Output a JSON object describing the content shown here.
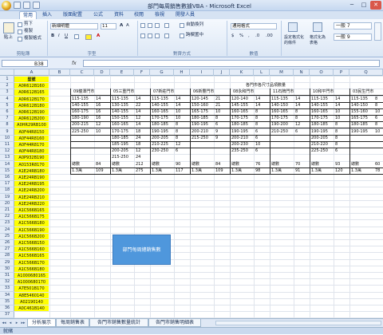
{
  "window": {
    "title": "部門每周銷售數據VBA - Microsoft Excel",
    "minimize": "─",
    "maximize": "□",
    "close": "✕"
  },
  "ribbon": {
    "tabs": [
      "常用",
      "插入",
      "版面配置",
      "公式",
      "資料",
      "校閱",
      "檢視",
      "開發人員"
    ],
    "paste": "貼上",
    "cut": "剪下",
    "copy": "複製",
    "format_painter": "複製格式",
    "font_name": "新細明體",
    "font_size": "11",
    "wrap_text": "自動換列",
    "merge_center": "跨欄置中",
    "number_format": "通用格式",
    "conditional_format": "設定格式化\n的條件",
    "format_as_table": "格式化為\n表格",
    "style_1": "一般 7",
    "style_2": "一般 9",
    "groups": [
      "剪貼簿",
      "字型",
      "對齊方式",
      "數值"
    ]
  },
  "formula_bar": {
    "name_box": "B38",
    "fx": "fx",
    "value": ""
  },
  "columns": [
    "A",
    "B",
    "C",
    "D",
    "E",
    "F",
    "G",
    "H",
    "I",
    "J",
    "K",
    "L",
    "M",
    "N",
    "O",
    "P",
    "Q"
  ],
  "rows": [
    "1",
    "2",
    "3",
    "4",
    "5",
    "6",
    "7",
    "8",
    "9",
    "10",
    "11",
    "12",
    "13",
    "14",
    "15",
    "16",
    "17",
    "18",
    "19",
    "20",
    "21",
    "22",
    "23",
    "24",
    "25",
    "26",
    "27",
    "28",
    "29",
    "30",
    "31",
    "32",
    "33",
    "34",
    "35",
    "36",
    "37"
  ],
  "col_a": [
    "型號",
    "A0R612B160",
    "A0R612B165",
    "A0R612B170",
    "A0R612B180",
    "A0R612B190",
    "A0R612B200",
    "A0HR29RB100",
    "A0F44R8150",
    "A0F44R8160",
    "A0F44R8170",
    "A0F44R8180",
    "A0P932B190",
    "A0153R8170",
    "A1E24RB180",
    "A1E24RB190",
    "A1E24RB195",
    "A1E24RB200",
    "A1E24RB210",
    "A1E24RB220",
    "A1C566B165",
    "A1C566B175",
    "A1C566B180",
    "A1C566B190",
    "A1C566B200",
    "A1C566B150",
    "A1C566B160",
    "A1C566B165",
    "A1C566B170",
    "A1C566B180",
    "A1000680165",
    "A1000680170",
    "A7E501B170",
    "A8E5460140",
    "A02190140",
    "A0C461B140"
  ],
  "table": {
    "title": "各門市各尺寸品項數量",
    "stores": [
      {
        "name": "09龍潭門市",
        "rows": [
          [
            "115-135",
            "14"
          ],
          [
            "140-155",
            "16"
          ],
          [
            "160-175",
            "16"
          ],
          [
            "180-190",
            "16"
          ],
          [
            "200-215",
            "12"
          ],
          [
            "225-250",
            "10"
          ]
        ],
        "sales_label": "總數",
        "sales": "84",
        "sold_label": "1.3萬",
        "sold": "109"
      },
      {
        "name": "05三重門市",
        "rows": [
          [
            "115-135",
            "14"
          ],
          [
            "130-135",
            "22"
          ],
          [
            "140-155",
            "14"
          ],
          [
            "150-155",
            "12"
          ],
          [
            "160-165",
            "14"
          ],
          [
            "170-175",
            "18"
          ],
          [
            "180-185",
            "24"
          ],
          [
            "185-195",
            "18"
          ],
          [
            "200-205",
            "12"
          ],
          [
            "215-250",
            "24"
          ]
        ],
        "sales_label": "總數",
        "sales": "212",
        "sold_label": "1.3萬",
        "sold": "275"
      },
      {
        "name": "07新莊門市",
        "rows": [
          [
            "115-135",
            "14"
          ],
          [
            "140-155",
            "14"
          ],
          [
            "160-165",
            "10"
          ],
          [
            "170-175",
            "10"
          ],
          [
            "180-185",
            "8"
          ],
          [
            "190-195",
            "8"
          ],
          [
            "200-205",
            "8"
          ],
          [
            "210-225",
            "12"
          ],
          [
            "230-250",
            "6"
          ]
        ],
        "sales_label": "總數",
        "sales": "90",
        "sold_label": "1.3萬",
        "sold": "117"
      },
      {
        "name": "06新豐門市",
        "rows": [
          [
            "120-145",
            "21"
          ],
          [
            "150-160",
            "21"
          ],
          [
            "165-175",
            "10"
          ],
          [
            "180-185",
            "8"
          ],
          [
            "190-195",
            "6"
          ],
          [
            "200-210",
            "9"
          ],
          [
            "215-250",
            "9"
          ]
        ],
        "sales_label": "總數",
        "sales": "84",
        "sold_label": "1.3萬",
        "sold": "109"
      },
      {
        "name": "08永和門市",
        "rows": [
          [
            "120-140",
            "14"
          ],
          [
            "145-155",
            "14"
          ],
          [
            "160-165",
            "8"
          ],
          [
            "170-175",
            "8"
          ],
          [
            "180-185",
            "8"
          ],
          [
            "190-195",
            "6"
          ],
          [
            "200-210",
            "6"
          ],
          [
            "200-230",
            "10"
          ],
          [
            "235-250",
            "6"
          ]
        ],
        "sales_label": "總數",
        "sales": "76",
        "sold_label": "1.3萬",
        "sold": "98"
      },
      {
        "name": "11石牌門市",
        "rows": [
          [
            "115-135",
            "14"
          ],
          [
            "140-150",
            "14"
          ],
          [
            "160-165",
            "8"
          ],
          [
            "170-175",
            "8"
          ],
          [
            "190-200",
            "12"
          ],
          [
            "210-250",
            "6"
          ]
        ],
        "sales_label": "總數",
        "sales": "70",
        "sold_label": "1.3萬",
        "sold": "91"
      },
      {
        "name": "10和平門市",
        "rows": [
          [
            "115-135",
            "14"
          ],
          [
            "140-155",
            "14"
          ],
          [
            "160-165",
            "10"
          ],
          [
            "170-175",
            "10"
          ],
          [
            "180-185",
            "8"
          ],
          [
            "190-195",
            "8"
          ],
          [
            "200-205",
            "8"
          ],
          [
            "210-220",
            "8"
          ],
          [
            "225-250",
            "6"
          ]
        ],
        "sales_label": "總數",
        "sales": "93",
        "sold_label": "1.3萬",
        "sold": "120"
      },
      {
        "name": "03民生門市",
        "rows": [
          [
            "115-135",
            "8"
          ],
          [
            "140-150",
            "8"
          ],
          [
            "155-160",
            "10"
          ],
          [
            "165-175",
            "6"
          ],
          [
            "180-185",
            "8"
          ],
          [
            "190-195",
            "10"
          ]
        ],
        "sales_label": "總數",
        "sales": "60",
        "sold_label": "1.3萬",
        "sold": "78"
      }
    ]
  },
  "vba_button": "部門每周總銷售數",
  "sheet_tabs": [
    "分析展示",
    "每周銷售表",
    "各門市銷售數量統計",
    "各門市銷售明細表"
  ],
  "sheet_nav": [
    "◂◂",
    "◂",
    "▸",
    "▸▸"
  ],
  "status": "就緒"
}
